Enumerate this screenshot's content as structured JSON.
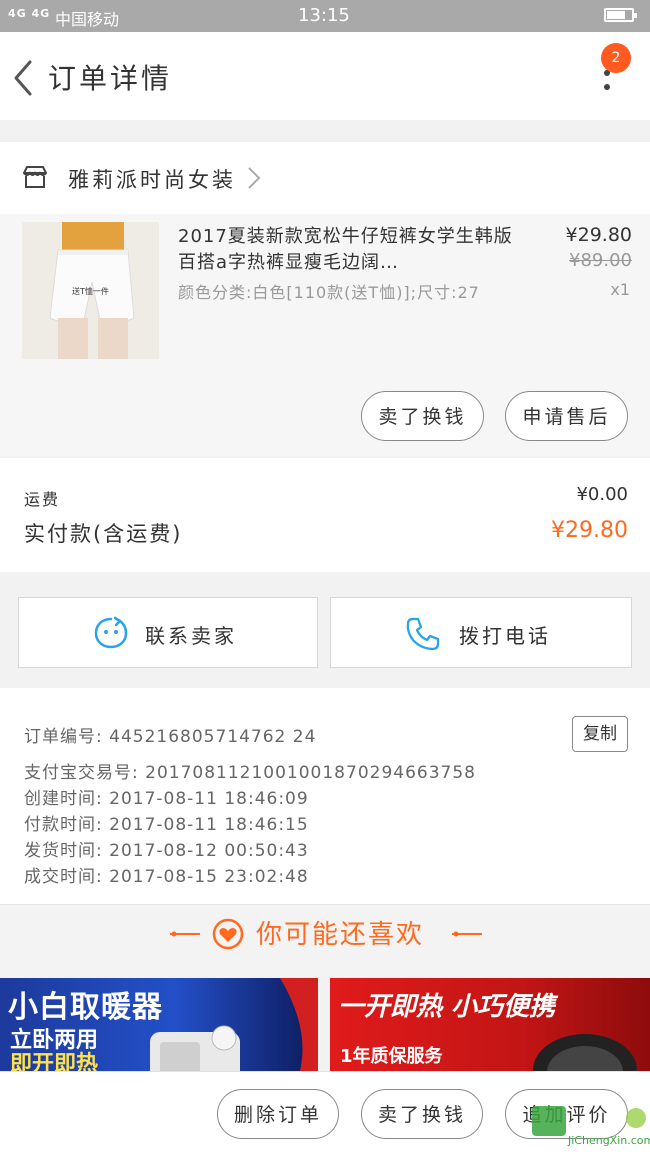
{
  "status_bar": {
    "signal": "4G 4G",
    "carrier": "中国移动",
    "time": "13:15"
  },
  "header": {
    "title": "订单详情",
    "badge_count": "2"
  },
  "shop": {
    "name": "雅莉派时尚女装"
  },
  "product": {
    "title": "2017夏装新款宽松牛仔短裤女学生韩版百搭a字热裤显瘦毛边阔…",
    "sku": "颜色分类:白色[110款(送T恤)];尺寸:27",
    "price": "¥29.80",
    "original_price": "¥89.00",
    "quantity": "x1",
    "thumb_caption": "送T恤一件",
    "btn_refund": "卖了换钱",
    "btn_after_sale": "申请售后"
  },
  "fees": {
    "shipping_label": "运费",
    "shipping_value": "¥0.00",
    "paid_label": "实付款(含运费)",
    "paid_value": "¥29.80"
  },
  "contact": {
    "seller_label": "联系卖家",
    "phone_label": "拨打电话"
  },
  "order_info": {
    "order_no": "订单编号: 445216805714762 24",
    "copy_label": "复制",
    "alipay_no": "支付宝交易号: 2017081121001001870294663758",
    "created": "创建时间: 2017-08-11  18:46:09",
    "paid": "付款时间: 2017-08-11  18:46:15",
    "shipped": "发货时间: 2017-08-12  00:50:43",
    "completed": "成交时间: 2017-08-15  23:02:48"
  },
  "recommend": {
    "title": "你可能还喜欢"
  },
  "banners": {
    "left_line1": "小白取暖器",
    "left_line2": "立卧两用",
    "left_line3": "即开即热",
    "right_line1": "一开即热 小巧便携",
    "right_line2": "1年质保服务"
  },
  "bottom_bar": {
    "delete_label": "删除订单",
    "refund_label": "卖了换钱",
    "review_label": "追加评价"
  },
  "watermark": {
    "text": "JiChengXin.com"
  },
  "colors": {
    "accent": "#ff6a1e",
    "badge": "#ff5a1f",
    "icon_blue": "#2aa3e8"
  }
}
